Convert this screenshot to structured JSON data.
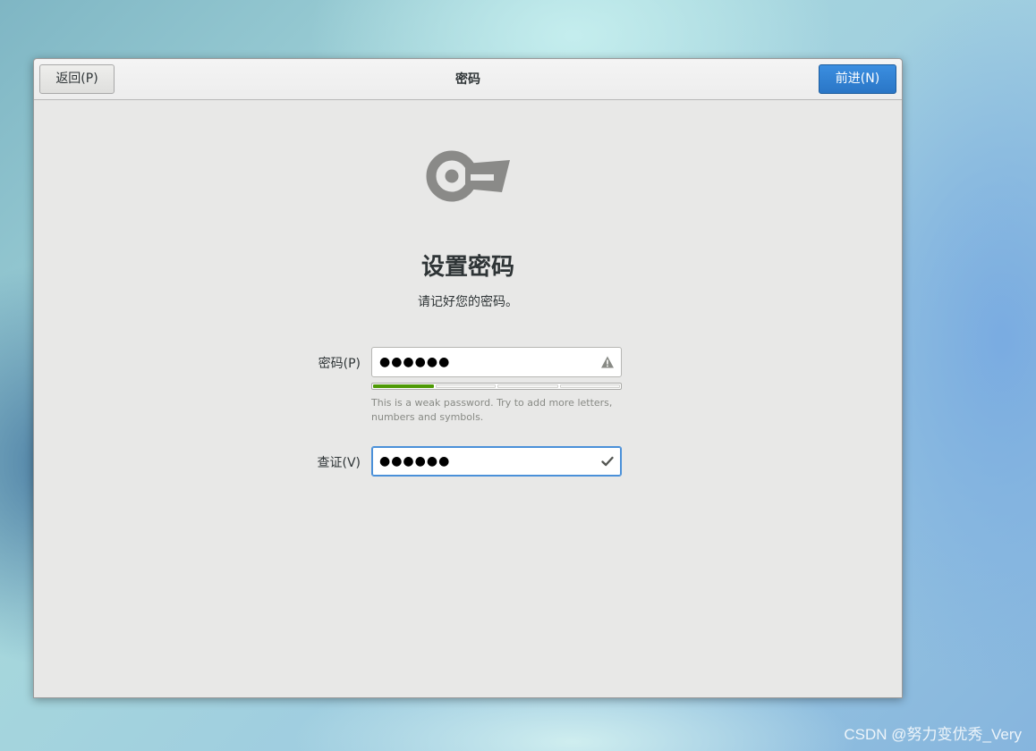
{
  "header": {
    "back_label": "返回(P)",
    "title": "密码",
    "next_label": "前进(N)"
  },
  "page": {
    "icon": "key-icon",
    "title": "设置密码",
    "subtitle": "请记好您的密码。"
  },
  "form": {
    "password_label": "密码(P)",
    "password_value": "●●●●●●",
    "password_status_icon": "warning-icon",
    "strength": {
      "segments": 4,
      "filled": 1,
      "color": "#4e9a06"
    },
    "hint": "This is a weak password. Try to add more letters, numbers and symbols.",
    "verify_label": "查证(V)",
    "verify_value": "●●●●●●",
    "verify_status_icon": "checkmark-icon"
  },
  "watermark": "CSDN @努力变优秀_Very",
  "colors": {
    "accent": "#2a76c6",
    "focus": "#4a90d9"
  }
}
